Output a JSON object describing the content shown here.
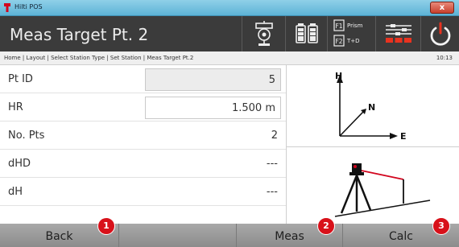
{
  "window": {
    "title": "Hilti POS",
    "close_glyph": "x"
  },
  "header": {
    "title": "Meas Target Pt. 2",
    "buttons": [
      {
        "name": "prism-target-icon"
      },
      {
        "name": "battery-icon"
      },
      {
        "name": "f1-prism-f2-tod-icon",
        "f1_key": "F1",
        "f1_label": "Prism",
        "f2_key": "F2",
        "f2_label": "T+D"
      },
      {
        "name": "settings-sliders-icon"
      },
      {
        "name": "power-icon"
      }
    ],
    "accent_color": "#e8321f"
  },
  "breadcrumb": {
    "path": "Home | Layout | Select Station Type | Set Station | Meas Target Pt.2",
    "time": "10:13"
  },
  "form": {
    "rows": [
      {
        "label": "Pt ID",
        "value": "5",
        "boxed": true,
        "shaded": true
      },
      {
        "label": "HR",
        "value": "1.500 m",
        "boxed": true,
        "shaded": false
      },
      {
        "label": "No. Pts",
        "value": "2"
      },
      {
        "label": "dHD",
        "value": "---"
      },
      {
        "label": "dH",
        "value": "---"
      }
    ]
  },
  "diagram": {
    "axis_labels": {
      "h": "H",
      "n": "N",
      "e": "E"
    }
  },
  "footer": {
    "back_label": "Back",
    "meas_label": "Meas",
    "calc_label": "Calc",
    "callouts": [
      "1",
      "2",
      "3"
    ]
  }
}
